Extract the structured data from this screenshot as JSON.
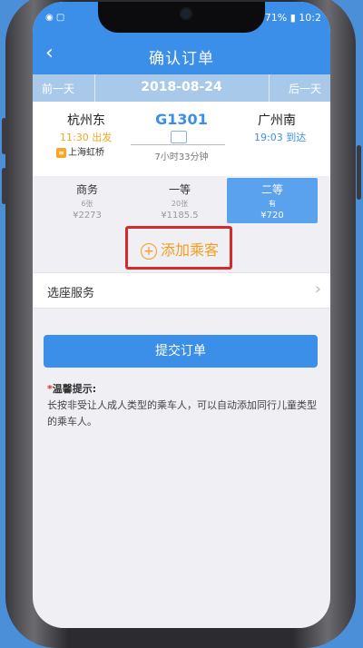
{
  "status_bar": {
    "left": "◉ ▢",
    "right": "71% ▮ 10:2"
  },
  "nav": {
    "back": "‹",
    "title": "确认订单"
  },
  "date_bar": {
    "prev": "前一天",
    "date": "2018-08-24",
    "next": "后一天"
  },
  "train": {
    "from_station": "杭州东",
    "from_time": "11:30 出发",
    "from_sub_badge": "≡",
    "from_sub": "上海虹桥",
    "number": "G1301",
    "duration": "7小时33分钟",
    "to_station": "广州南",
    "to_time": "19:03 到达"
  },
  "seats": [
    {
      "name": "商务",
      "count": "6张",
      "price": "¥2273"
    },
    {
      "name": "一等",
      "count": "20张",
      "price": "¥1185.5"
    },
    {
      "name": "二等",
      "count": "有",
      "price": "¥720"
    }
  ],
  "add_passenger": {
    "icon": "+",
    "label": "添加乘客"
  },
  "service": {
    "label": "选座服务",
    "arrow": "›"
  },
  "submit": {
    "label": "提交订单"
  },
  "tips": {
    "star": "*",
    "title": "温馨提示:",
    "body": "长按非受让人成人类型的乘车人，可以自动添加同行儿童类型的乘车人。"
  },
  "colors": {
    "accent": "#3b8fe8",
    "highlight": "#f5a623",
    "alert_frame": "#d42a2a"
  }
}
